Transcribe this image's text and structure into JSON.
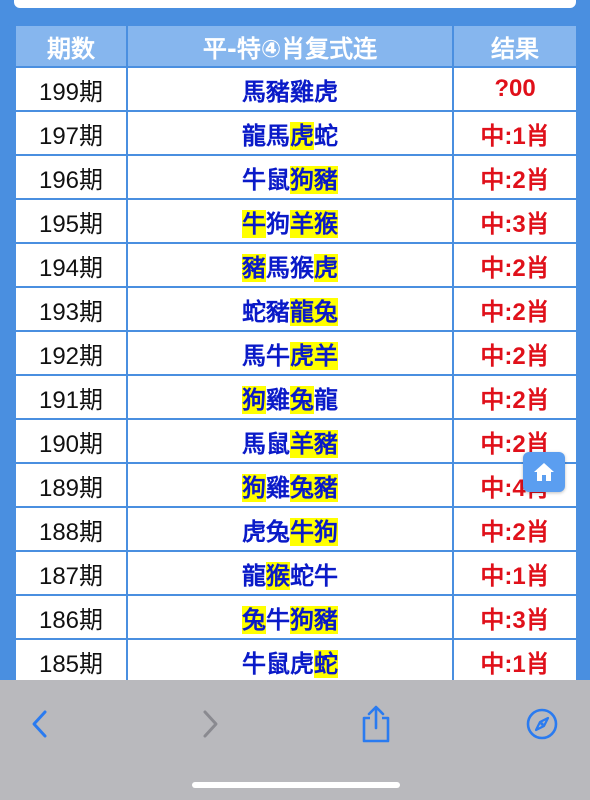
{
  "table": {
    "headers": [
      "期数",
      "平-特④肖复式连",
      "结果"
    ],
    "rows": [
      {
        "period": "199期",
        "zodiac": [
          {
            "t": "馬",
            "h": false
          },
          {
            "t": "豬",
            "h": false
          },
          {
            "t": "雞",
            "h": false
          },
          {
            "t": "虎",
            "h": false
          }
        ],
        "result": "?00"
      },
      {
        "period": "197期",
        "zodiac": [
          {
            "t": "龍",
            "h": false
          },
          {
            "t": "馬",
            "h": false
          },
          {
            "t": "虎",
            "h": true
          },
          {
            "t": "蛇",
            "h": false
          }
        ],
        "result": "中:1肖"
      },
      {
        "period": "196期",
        "zodiac": [
          {
            "t": "牛",
            "h": false
          },
          {
            "t": "鼠",
            "h": false
          },
          {
            "t": "狗",
            "h": true
          },
          {
            "t": "豬",
            "h": true
          }
        ],
        "result": "中:2肖"
      },
      {
        "period": "195期",
        "zodiac": [
          {
            "t": "牛",
            "h": true
          },
          {
            "t": "狗",
            "h": false
          },
          {
            "t": "羊",
            "h": true
          },
          {
            "t": "猴",
            "h": true
          }
        ],
        "result": "中:3肖"
      },
      {
        "period": "194期",
        "zodiac": [
          {
            "t": "豬",
            "h": true
          },
          {
            "t": "馬",
            "h": false
          },
          {
            "t": "猴",
            "h": false
          },
          {
            "t": "虎",
            "h": true
          }
        ],
        "result": "中:2肖"
      },
      {
        "period": "193期",
        "zodiac": [
          {
            "t": "蛇",
            "h": false
          },
          {
            "t": "豬",
            "h": false
          },
          {
            "t": "龍",
            "h": true
          },
          {
            "t": "兔",
            "h": true
          }
        ],
        "result": "中:2肖"
      },
      {
        "period": "192期",
        "zodiac": [
          {
            "t": "馬",
            "h": false
          },
          {
            "t": "牛",
            "h": false
          },
          {
            "t": "虎",
            "h": true
          },
          {
            "t": "羊",
            "h": true
          }
        ],
        "result": "中:2肖"
      },
      {
        "period": "191期",
        "zodiac": [
          {
            "t": "狗",
            "h": true
          },
          {
            "t": "雞",
            "h": false
          },
          {
            "t": "兔",
            "h": true
          },
          {
            "t": "龍",
            "h": false
          }
        ],
        "result": "中:2肖"
      },
      {
        "period": "190期",
        "zodiac": [
          {
            "t": "馬",
            "h": false
          },
          {
            "t": "鼠",
            "h": false
          },
          {
            "t": "羊",
            "h": true
          },
          {
            "t": "豬",
            "h": true
          }
        ],
        "result": "中:2肖"
      },
      {
        "period": "189期",
        "zodiac": [
          {
            "t": "狗",
            "h": true
          },
          {
            "t": "雞",
            "h": false
          },
          {
            "t": "兔",
            "h": true
          },
          {
            "t": "豬",
            "h": true
          }
        ],
        "result": "中:4肖"
      },
      {
        "period": "188期",
        "zodiac": [
          {
            "t": "虎",
            "h": false
          },
          {
            "t": "兔",
            "h": false
          },
          {
            "t": "牛",
            "h": true
          },
          {
            "t": "狗",
            "h": true
          }
        ],
        "result": "中:2肖"
      },
      {
        "period": "187期",
        "zodiac": [
          {
            "t": "龍",
            "h": false
          },
          {
            "t": "猴",
            "h": true
          },
          {
            "t": "蛇",
            "h": false
          },
          {
            "t": "牛",
            "h": false
          }
        ],
        "result": "中:1肖"
      },
      {
        "period": "186期",
        "zodiac": [
          {
            "t": "兔",
            "h": true
          },
          {
            "t": "牛",
            "h": false
          },
          {
            "t": "狗",
            "h": true
          },
          {
            "t": "豬",
            "h": true
          }
        ],
        "result": "中:3肖"
      },
      {
        "period": "185期",
        "zodiac": [
          {
            "t": "牛",
            "h": false
          },
          {
            "t": "鼠",
            "h": false
          },
          {
            "t": "虎",
            "h": false
          },
          {
            "t": "蛇",
            "h": true
          }
        ],
        "result": "中:1肖"
      }
    ]
  },
  "colors": {
    "border": "#4a8fe0",
    "header_bg": "#86b6ee",
    "zodiac_text": "#0a1ac8",
    "highlight": "#ffff00",
    "result_text": "#e0101a",
    "toolbar_bg": "#b9b9bd",
    "toolbar_icon": "#2a7bf0"
  },
  "icons": {
    "floating": "home-icon",
    "toolbar": [
      "back-chevron-icon",
      "forward-chevron-icon",
      "share-icon",
      "compass-icon"
    ]
  }
}
